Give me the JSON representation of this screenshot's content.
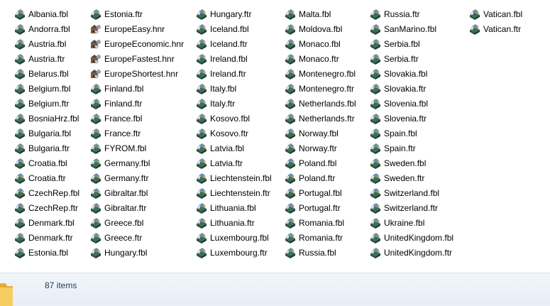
{
  "columns": [
    {
      "items": [
        {
          "name": "Albania.fbl",
          "icon": "fbl-file-icon"
        },
        {
          "name": "Andorra.fbl",
          "icon": "fbl-file-icon"
        },
        {
          "name": "Austria.fbl",
          "icon": "fbl-file-icon"
        },
        {
          "name": "Austria.ftr",
          "icon": "ftr-file-icon"
        },
        {
          "name": "Belarus.fbl",
          "icon": "fbl-file-icon"
        },
        {
          "name": "Belgium.fbl",
          "icon": "fbl-file-icon"
        },
        {
          "name": "Belgium.ftr",
          "icon": "ftr-file-icon"
        },
        {
          "name": "BosniaHrz.fbl",
          "icon": "fbl-file-icon"
        },
        {
          "name": "Bulgaria.fbl",
          "icon": "fbl-file-icon"
        },
        {
          "name": "Bulgaria.ftr",
          "icon": "ftr-file-icon"
        },
        {
          "name": "Croatia.fbl",
          "icon": "fbl-file-icon"
        },
        {
          "name": "Croatia.ftr",
          "icon": "ftr-file-icon"
        },
        {
          "name": "CzechRep.fbl",
          "icon": "fbl-file-icon"
        },
        {
          "name": "CzechRep.ftr",
          "icon": "ftr-file-icon"
        },
        {
          "name": "Denmark.fbl",
          "icon": "fbl-file-icon"
        },
        {
          "name": "Denmark.ftr",
          "icon": "ftr-file-icon"
        },
        {
          "name": "Estonia.fbl",
          "icon": "fbl-file-icon"
        }
      ]
    },
    {
      "items": [
        {
          "name": "Estonia.ftr",
          "icon": "ftr-file-icon"
        },
        {
          "name": "EuropeEasy.hnr",
          "icon": "hnr-file-icon"
        },
        {
          "name": "EuropeEconomic.hnr",
          "icon": "hnr-file-icon"
        },
        {
          "name": "EuropeFastest.hnr",
          "icon": "hnr-file-icon"
        },
        {
          "name": "EuropeShortest.hnr",
          "icon": "hnr-file-icon"
        },
        {
          "name": "Finland.fbl",
          "icon": "fbl-file-icon"
        },
        {
          "name": "Finland.ftr",
          "icon": "ftr-file-icon"
        },
        {
          "name": "France.fbl",
          "icon": "fbl-file-icon"
        },
        {
          "name": "France.ftr",
          "icon": "ftr-file-icon"
        },
        {
          "name": "FYROM.fbl",
          "icon": "fbl-file-icon"
        },
        {
          "name": "Germany.fbl",
          "icon": "fbl-file-icon"
        },
        {
          "name": "Germany.ftr",
          "icon": "ftr-file-icon"
        },
        {
          "name": "Gibraltar.fbl",
          "icon": "fbl-file-icon"
        },
        {
          "name": "Gibraltar.ftr",
          "icon": "ftr-file-icon"
        },
        {
          "name": "Greece.fbl",
          "icon": "fbl-file-icon"
        },
        {
          "name": "Greece.ftr",
          "icon": "ftr-file-icon"
        },
        {
          "name": "Hungary.fbl",
          "icon": "fbl-file-icon"
        }
      ]
    },
    {
      "items": [
        {
          "name": "Hungary.ftr",
          "icon": "ftr-file-icon"
        },
        {
          "name": "Iceland.fbl",
          "icon": "fbl-file-icon"
        },
        {
          "name": "Iceland.ftr",
          "icon": "ftr-file-icon"
        },
        {
          "name": "Ireland.fbl",
          "icon": "fbl-file-icon"
        },
        {
          "name": "Ireland.ftr",
          "icon": "ftr-file-icon"
        },
        {
          "name": "Italy.fbl",
          "icon": "fbl-file-icon"
        },
        {
          "name": "Italy.ftr",
          "icon": "ftr-file-icon"
        },
        {
          "name": "Kosovo.fbl",
          "icon": "fbl-file-icon"
        },
        {
          "name": "Kosovo.ftr",
          "icon": "ftr-file-icon"
        },
        {
          "name": "Latvia.fbl",
          "icon": "fbl-file-icon"
        },
        {
          "name": "Latvia.ftr",
          "icon": "ftr-file-icon"
        },
        {
          "name": "Liechtenstein.fbl",
          "icon": "fbl-file-icon"
        },
        {
          "name": "Liechtenstein.ftr",
          "icon": "ftr-file-icon"
        },
        {
          "name": "Lithuania.fbl",
          "icon": "fbl-file-icon"
        },
        {
          "name": "Lithuania.ftr",
          "icon": "ftr-file-icon"
        },
        {
          "name": "Luxembourg.fbl",
          "icon": "fbl-file-icon"
        },
        {
          "name": "Luxembourg.ftr",
          "icon": "ftr-file-icon"
        }
      ]
    },
    {
      "items": [
        {
          "name": "Malta.fbl",
          "icon": "fbl-file-icon"
        },
        {
          "name": "Moldova.fbl",
          "icon": "fbl-file-icon"
        },
        {
          "name": "Monaco.fbl",
          "icon": "fbl-file-icon"
        },
        {
          "name": "Monaco.ftr",
          "icon": "ftr-file-icon"
        },
        {
          "name": "Montenegro.fbl",
          "icon": "fbl-file-icon"
        },
        {
          "name": "Montenegro.ftr",
          "icon": "ftr-file-icon"
        },
        {
          "name": "Netherlands.fbl",
          "icon": "fbl-file-icon"
        },
        {
          "name": "Netherlands.ftr",
          "icon": "ftr-file-icon"
        },
        {
          "name": "Norway.fbl",
          "icon": "fbl-file-icon"
        },
        {
          "name": "Norway.ftr",
          "icon": "ftr-file-icon"
        },
        {
          "name": "Poland.fbl",
          "icon": "fbl-file-icon"
        },
        {
          "name": "Poland.ftr",
          "icon": "ftr-file-icon"
        },
        {
          "name": "Portugal.fbl",
          "icon": "fbl-file-icon"
        },
        {
          "name": "Portugal.ftr",
          "icon": "ftr-file-icon"
        },
        {
          "name": "Romania.fbl",
          "icon": "fbl-file-icon"
        },
        {
          "name": "Romania.ftr",
          "icon": "ftr-file-icon"
        },
        {
          "name": "Russia.fbl",
          "icon": "fbl-file-icon"
        }
      ]
    },
    {
      "items": [
        {
          "name": "Russia.ftr",
          "icon": "ftr-file-icon"
        },
        {
          "name": "SanMarino.fbl",
          "icon": "fbl-file-icon"
        },
        {
          "name": "Serbia.fbl",
          "icon": "fbl-file-icon"
        },
        {
          "name": "Serbia.ftr",
          "icon": "ftr-file-icon"
        },
        {
          "name": "Slovakia.fbl",
          "icon": "fbl-file-icon"
        },
        {
          "name": "Slovakia.ftr",
          "icon": "ftr-file-icon"
        },
        {
          "name": "Slovenia.fbl",
          "icon": "fbl-file-icon"
        },
        {
          "name": "Slovenia.ftr",
          "icon": "ftr-file-icon"
        },
        {
          "name": "Spain.fbl",
          "icon": "fbl-file-icon"
        },
        {
          "name": "Spain.ftr",
          "icon": "ftr-file-icon"
        },
        {
          "name": "Sweden.fbl",
          "icon": "fbl-file-icon"
        },
        {
          "name": "Sweden.ftr",
          "icon": "ftr-file-icon"
        },
        {
          "name": "Switzerland.fbl",
          "icon": "fbl-file-icon"
        },
        {
          "name": "Switzerland.ftr",
          "icon": "ftr-file-icon"
        },
        {
          "name": "Ukraine.fbl",
          "icon": "fbl-file-icon"
        },
        {
          "name": "UnitedKingdom.fbl",
          "icon": "fbl-file-icon"
        },
        {
          "name": "UnitedKingdom.ftr",
          "icon": "ftr-file-icon"
        }
      ]
    },
    {
      "items": [
        {
          "name": "Vatican.fbl",
          "icon": "fbl-file-icon"
        },
        {
          "name": "Vatican.ftr",
          "icon": "ftr-file-icon"
        }
      ]
    }
  ],
  "status_bar": {
    "item_count": "87 items",
    "icon": "folder-icon"
  },
  "colors": {
    "status_text": "#1e395b",
    "status_bg": "#eef3fa",
    "folder": "#f3c14f"
  }
}
